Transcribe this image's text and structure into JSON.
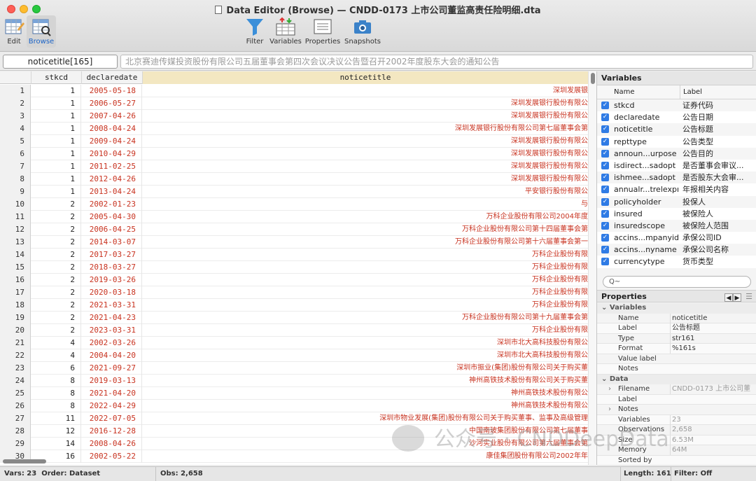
{
  "window": {
    "title": "Data Editor (Browse) — CNDD-0173 上市公司董监高责任险明细.dta"
  },
  "toolbar": {
    "edit": "Edit",
    "browse": "Browse",
    "filter": "Filter",
    "variables": "Variables",
    "properties": "Properties",
    "snapshots": "Snapshots"
  },
  "command": {
    "cell_name": "noticetitle[165]",
    "cell_value": "北京赛迪传媒投资股份有限公司五届董事会第四次会议决议公告暨召开2002年度股东大会的通知公告"
  },
  "grid": {
    "columns": [
      "stkcd",
      "declaredate",
      "noticetitle"
    ],
    "rows": [
      {
        "n": "1",
        "stkcd": "1",
        "date": "2005-05-18",
        "title": "深圳发展银"
      },
      {
        "n": "2",
        "stkcd": "1",
        "date": "2006-05-27",
        "title": "深圳发展银行股份有限公"
      },
      {
        "n": "3",
        "stkcd": "1",
        "date": "2007-04-26",
        "title": "深圳发展银行股份有限公"
      },
      {
        "n": "4",
        "stkcd": "1",
        "date": "2008-04-24",
        "title": "深圳发展银行股份有限公司第七届董事会第"
      },
      {
        "n": "5",
        "stkcd": "1",
        "date": "2009-04-24",
        "title": "深圳发展银行股份有限公"
      },
      {
        "n": "6",
        "stkcd": "1",
        "date": "2010-04-29",
        "title": "深圳发展银行股份有限公"
      },
      {
        "n": "7",
        "stkcd": "1",
        "date": "2011-02-25",
        "title": "深圳发展银行股份有限公"
      },
      {
        "n": "8",
        "stkcd": "1",
        "date": "2012-04-26",
        "title": "深圳发展银行股份有限公"
      },
      {
        "n": "9",
        "stkcd": "1",
        "date": "2013-04-24",
        "title": "平安银行股份有限公"
      },
      {
        "n": "10",
        "stkcd": "2",
        "date": "2002-01-23",
        "title": "与"
      },
      {
        "n": "11",
        "stkcd": "2",
        "date": "2005-04-30",
        "title": "万科企业股份有限公司2004年度"
      },
      {
        "n": "12",
        "stkcd": "2",
        "date": "2006-04-25",
        "title": "万科企业股份有限公司第十四届董事会第"
      },
      {
        "n": "13",
        "stkcd": "2",
        "date": "2014-03-07",
        "title": "万科企业股份有限公司第十六届董事会第一"
      },
      {
        "n": "14",
        "stkcd": "2",
        "date": "2017-03-27",
        "title": "万科企业股份有限"
      },
      {
        "n": "15",
        "stkcd": "2",
        "date": "2018-03-27",
        "title": "万科企业股份有限"
      },
      {
        "n": "16",
        "stkcd": "2",
        "date": "2019-03-26",
        "title": "万科企业股份有限"
      },
      {
        "n": "17",
        "stkcd": "2",
        "date": "2020-03-18",
        "title": "万科企业股份有限"
      },
      {
        "n": "18",
        "stkcd": "2",
        "date": "2021-03-31",
        "title": "万科企业股份有限"
      },
      {
        "n": "19",
        "stkcd": "2",
        "date": "2021-04-23",
        "title": "万科企业股份有限公司第十九届董事会第"
      },
      {
        "n": "20",
        "stkcd": "2",
        "date": "2023-03-31",
        "title": "万科企业股份有限"
      },
      {
        "n": "21",
        "stkcd": "4",
        "date": "2002-03-26",
        "title": "深圳市北大高科技股份有限公"
      },
      {
        "n": "22",
        "stkcd": "4",
        "date": "2004-04-20",
        "title": "深圳市北大高科技股份有限公"
      },
      {
        "n": "23",
        "stkcd": "6",
        "date": "2021-09-27",
        "title": "深圳市振业(集团)股份有限公司关于购买董"
      },
      {
        "n": "24",
        "stkcd": "8",
        "date": "2019-03-13",
        "title": "神州高铁技术股份有限公司关于购买董"
      },
      {
        "n": "25",
        "stkcd": "8",
        "date": "2021-04-20",
        "title": "神州高铁技术股份有限公"
      },
      {
        "n": "26",
        "stkcd": "8",
        "date": "2022-04-29",
        "title": "神州高铁技术股份有限公"
      },
      {
        "n": "27",
        "stkcd": "11",
        "date": "2022-07-05",
        "title": "深圳市物业发展(集团)股份有限公司关于购买董事、监事及高级管理"
      },
      {
        "n": "28",
        "stkcd": "12",
        "date": "2016-12-28",
        "title": "中国南玻集团股份有限公司第七届董事"
      },
      {
        "n": "29",
        "stkcd": "14",
        "date": "2008-04-26",
        "title": "沙河实业股份有限公司第六届董事会第"
      },
      {
        "n": "30",
        "stkcd": "16",
        "date": "2002-05-22",
        "title": "康佳集团股份有限公司2002年年"
      }
    ]
  },
  "variables_panel": {
    "header": "Variables",
    "col_name": "Name",
    "col_label": "Label",
    "items": [
      {
        "name": "stkcd",
        "label": "证券代码"
      },
      {
        "name": "declaredate",
        "label": "公告日期"
      },
      {
        "name": "noticetitle",
        "label": "公告标题"
      },
      {
        "name": "repttype",
        "label": "公告类型"
      },
      {
        "name": "announ...urpose",
        "label": "公告目的"
      },
      {
        "name": "isdirect...sadopt",
        "label": "是否董事会审议..."
      },
      {
        "name": "ishmee...sadopt",
        "label": "是否股东大会审..."
      },
      {
        "name": "annualr...trelexpr",
        "label": "年报相关内容"
      },
      {
        "name": "policyholder",
        "label": "投保人"
      },
      {
        "name": "insured",
        "label": "被保险人"
      },
      {
        "name": "insuredscope",
        "label": "被保险人范围"
      },
      {
        "name": "accins...mpanyid",
        "label": "承保公司ID"
      },
      {
        "name": "accins...nyname",
        "label": "承保公司名称"
      },
      {
        "name": "currencytype",
        "label": "货币类型"
      }
    ],
    "search_placeholder": "Q~"
  },
  "properties_panel": {
    "header": "Properties",
    "variables_group": "Variables",
    "variables_rows": [
      {
        "key": "Name",
        "value": "noticetitle"
      },
      {
        "key": "Label",
        "value": "公告标题"
      },
      {
        "key": "Type",
        "value": "str161"
      },
      {
        "key": "Format",
        "value": "%161s"
      },
      {
        "key": "Value label",
        "value": ""
      },
      {
        "key": "Notes",
        "value": ""
      }
    ],
    "data_group": "Data",
    "data_rows": [
      {
        "key": "Filename",
        "value": "CNDD-0173 上市公司董",
        "expand": true
      },
      {
        "key": "Label",
        "value": "",
        "expand": false
      },
      {
        "key": "Notes",
        "value": "",
        "expand": true
      },
      {
        "key": "Variables",
        "value": "23",
        "expand": false
      },
      {
        "key": "Observations",
        "value": "2,658",
        "expand": false
      },
      {
        "key": "Size",
        "value": "6.53M",
        "expand": false
      },
      {
        "key": "Memory",
        "value": "64M",
        "expand": false
      },
      {
        "key": "Sorted by",
        "value": "",
        "expand": false
      }
    ]
  },
  "status": {
    "vars": "Vars: 23",
    "order": "Order: Dataset",
    "obs": "Obs: 2,658",
    "length": "Length: 161",
    "filter": "Filter: Off"
  },
  "watermark": {
    "text": "公众号 · CNDDeepData"
  },
  "colors": {
    "data_red": "#c8321f",
    "highlight_header": "#f3e7c1",
    "checkbox_blue": "#2f7be5"
  }
}
